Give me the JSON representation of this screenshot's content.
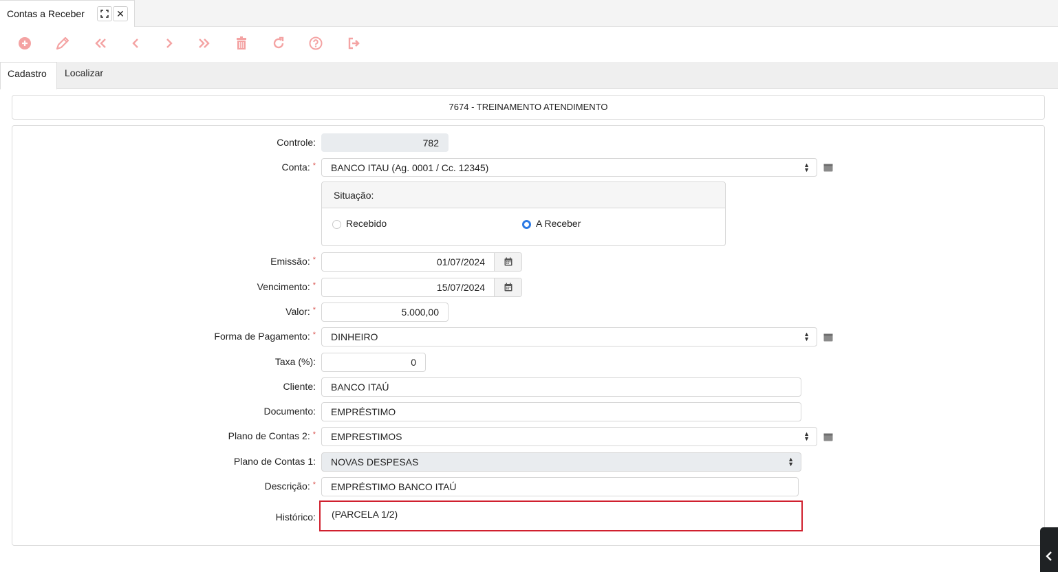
{
  "window_tab": {
    "title": "Contas a Receber",
    "expand_icon": "⛶",
    "close_icon": "✕"
  },
  "toolbar": {
    "color": "#f4a3a3",
    "buttons": [
      "plus-circle-icon",
      "pencil-icon",
      "first-icon",
      "prev-icon",
      "next-icon",
      "last-icon",
      "trash-icon",
      "refresh-icon",
      "help-icon",
      "exit-icon"
    ]
  },
  "tabs": {
    "cadastro": "Cadastro",
    "localizar": "Localizar"
  },
  "header": {
    "title": "7674 - TREINAMENTO ATENDIMENTO"
  },
  "form": {
    "controle": {
      "label": "Controle:",
      "value": "782"
    },
    "conta": {
      "label": "Conta:",
      "required": "*",
      "value": "BANCO ITAU (Ag. 0001 / Cc. 12345)"
    },
    "situacao": {
      "label": "Situação:",
      "options": [
        {
          "label": "Recebido",
          "selected": false
        },
        {
          "label": "A Receber",
          "selected": true
        }
      ]
    },
    "emissao": {
      "label": "Emissão:",
      "required": "*",
      "value": "01/07/2024"
    },
    "vencimento": {
      "label": "Vencimento:",
      "required": "*",
      "value": "15/07/2024"
    },
    "valor": {
      "label": "Valor:",
      "required": "*",
      "value": "5.000,00"
    },
    "forma_pagamento": {
      "label": "Forma de Pagamento:",
      "required": "*",
      "value": "DINHEIRO"
    },
    "taxa": {
      "label": "Taxa (%):",
      "value": "0"
    },
    "cliente": {
      "label": "Cliente:",
      "value": "BANCO ITAÚ"
    },
    "documento": {
      "label": "Documento:",
      "value": "EMPRÉSTIMO"
    },
    "plano2": {
      "label": "Plano de Contas 2:",
      "required": "*",
      "value": "EMPRESTIMOS"
    },
    "plano1": {
      "label": "Plano de Contas 1:",
      "value": "NOVAS DESPESAS"
    },
    "descricao": {
      "label": "Descrição:",
      "required": "*",
      "value": "EMPRÉSTIMO BANCO ITAÚ"
    },
    "historico": {
      "label": "Histórico:",
      "value": "(PARCELA 1/2)"
    }
  },
  "select_arrows": "▲\n▼",
  "accent_color": "#2d7be5",
  "highlight_color": "#d0202e"
}
